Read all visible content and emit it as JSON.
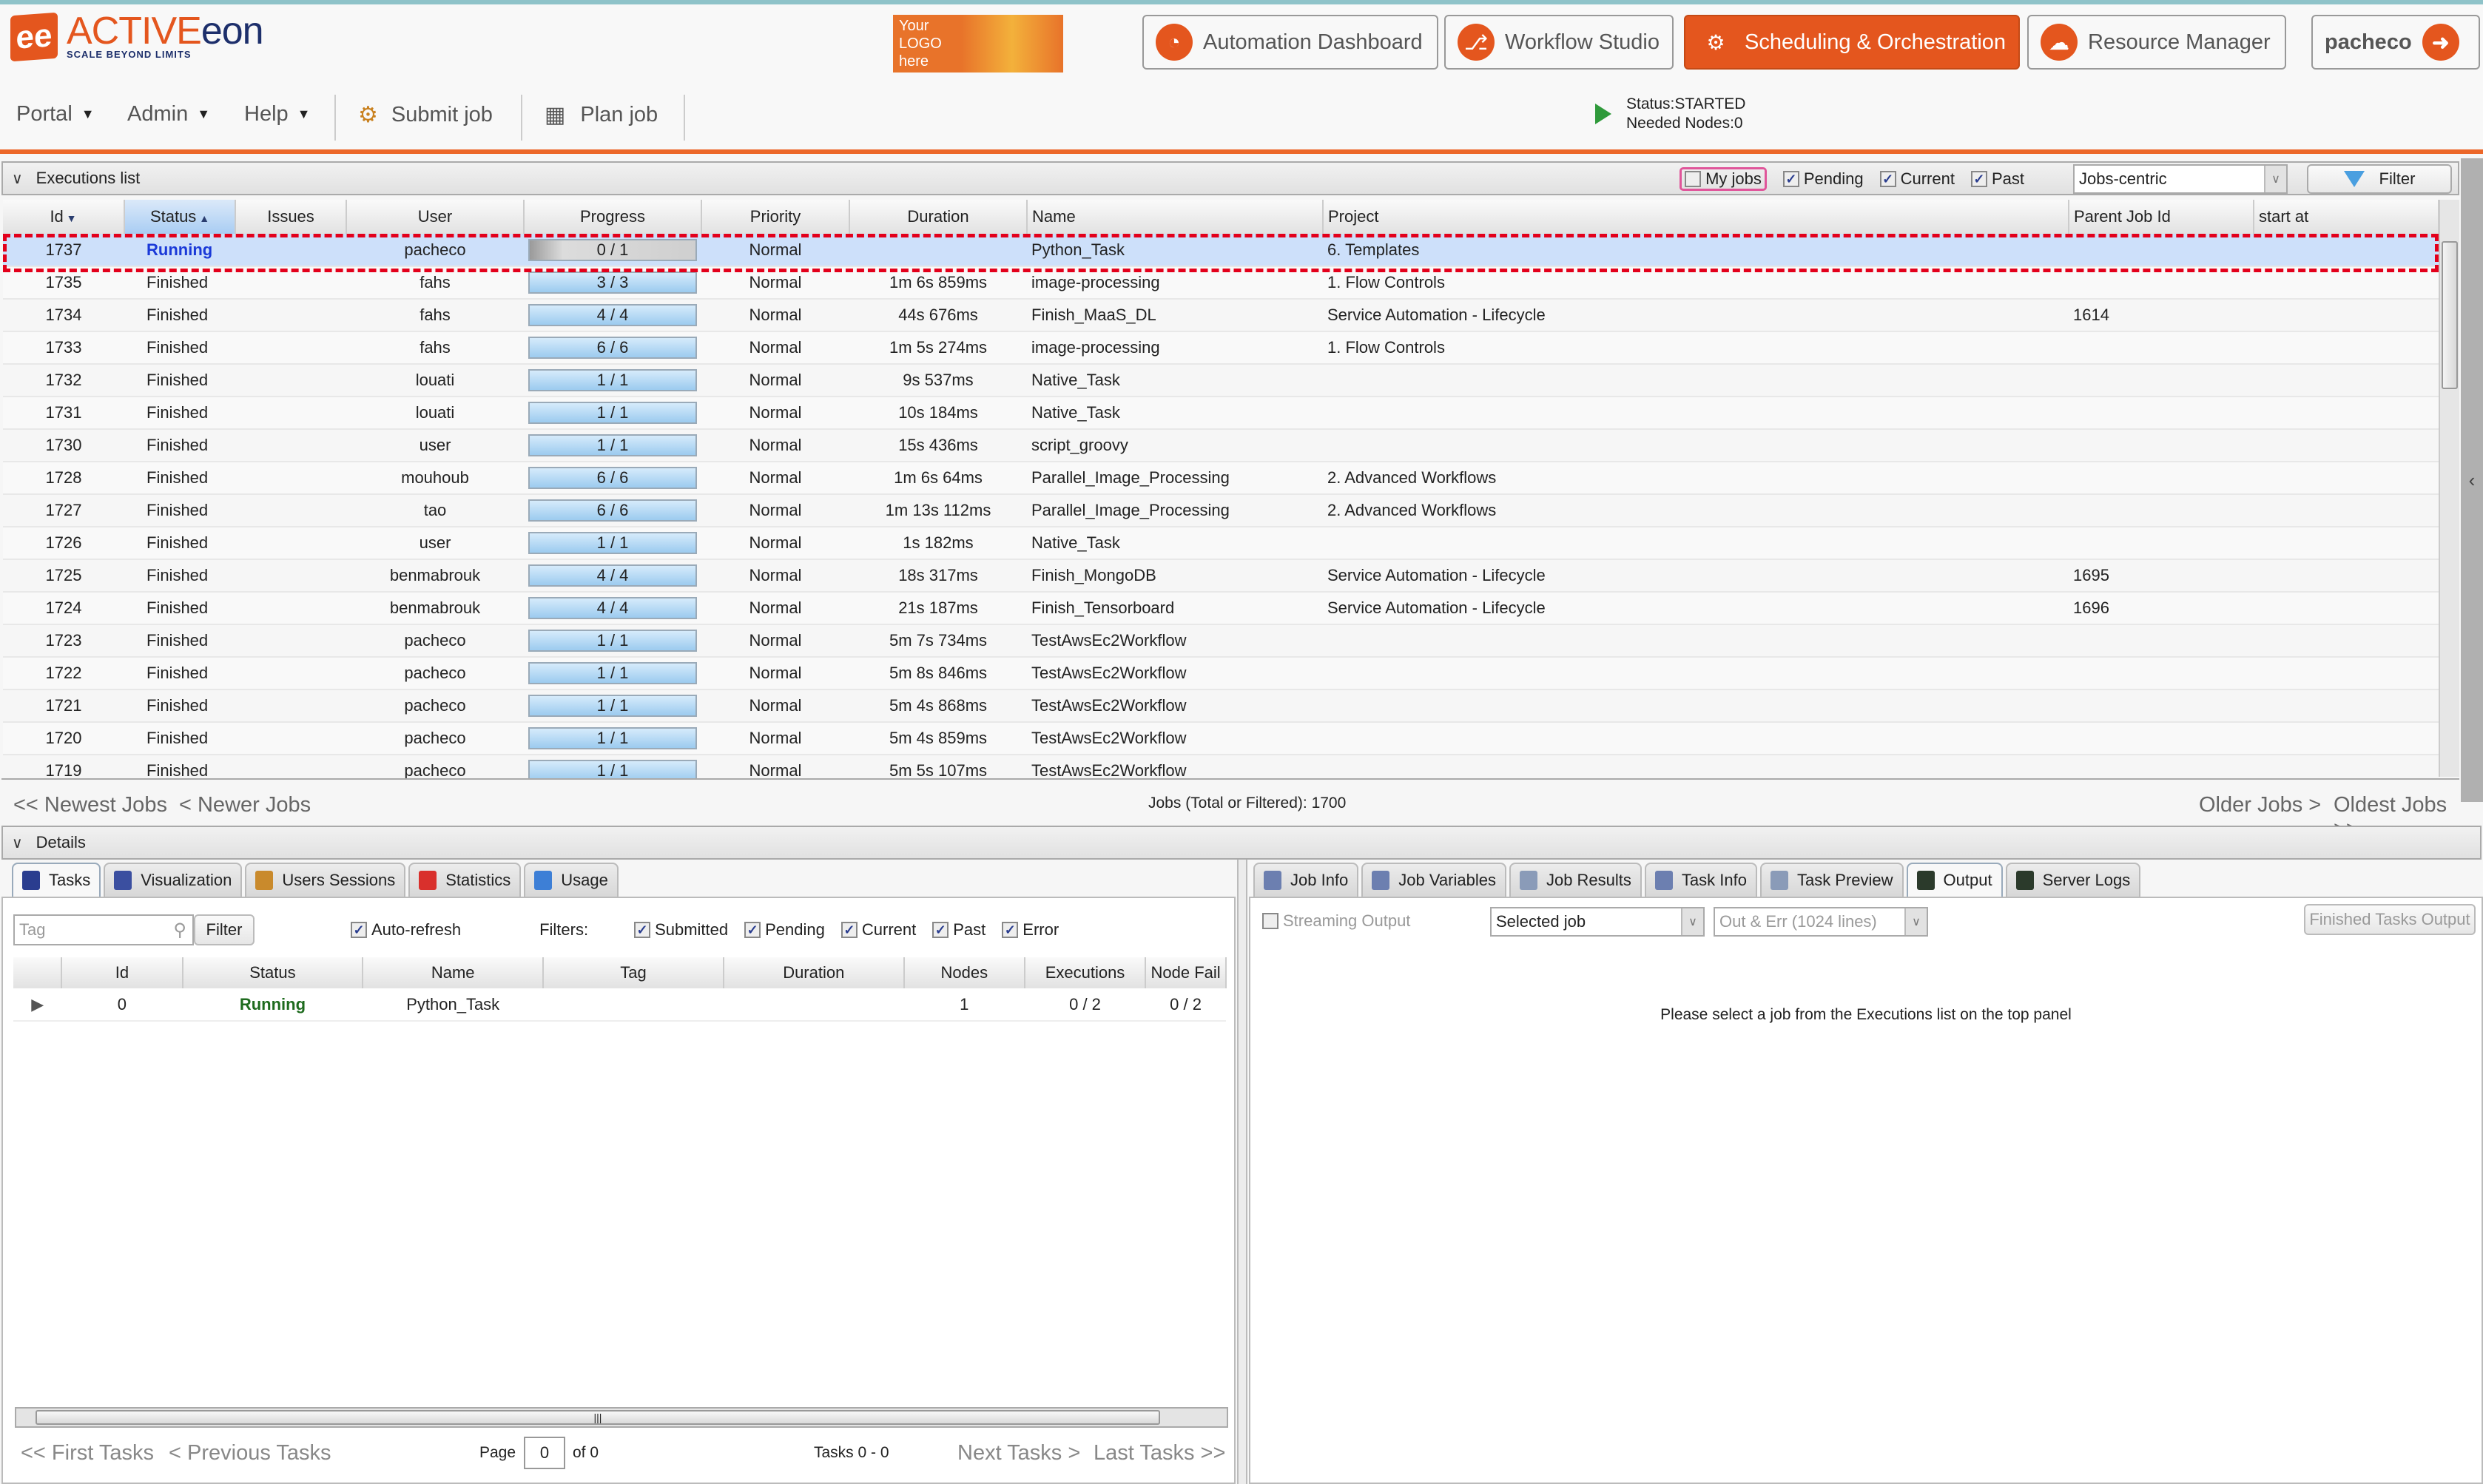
{
  "brand": {
    "name_a": "ACTIVE",
    "name_b": "eon",
    "tagline": "SCALE BEYOND LIMITS",
    "logo_mark": "ee",
    "custom_logo": [
      "Your",
      "LOGO",
      "here"
    ]
  },
  "nav": [
    {
      "label": "Automation Dashboard",
      "icon": "gauge-icon",
      "glyph": "◔",
      "active": false
    },
    {
      "label": "Workflow Studio",
      "icon": "workflow-icon",
      "glyph": "⎇",
      "active": false
    },
    {
      "label": "Scheduling & Orchestration",
      "icon": "gears-icon",
      "glyph": "⚙",
      "active": true
    },
    {
      "label": "Resource Manager",
      "icon": "cloud-icon",
      "glyph": "☁",
      "active": false
    }
  ],
  "user": {
    "name": "pacheco",
    "logout_glyph": "➜"
  },
  "toolbar": {
    "portal": "Portal",
    "admin": "Admin",
    "help": "Help",
    "submit": "Submit job",
    "plan": "Plan job",
    "caret": "▼"
  },
  "scheduler_status": {
    "status": "Status:STARTED",
    "needed_nodes": "Needed Nodes:0"
  },
  "executions": {
    "title": "Executions list",
    "filters": [
      {
        "label": "My jobs",
        "checked": false
      },
      {
        "label": "Pending",
        "checked": true
      },
      {
        "label": "Current",
        "checked": true
      },
      {
        "label": "Past",
        "checked": true
      }
    ],
    "view_mode": "Jobs-centric",
    "filter_button": "Filter",
    "columns": [
      "Id",
      "Status",
      "Issues",
      "User",
      "Progress",
      "Priority",
      "Duration",
      "Name",
      "Project",
      "Parent Job Id",
      "start at"
    ],
    "sort": {
      "Id": "desc",
      "Status": "asc"
    },
    "rows": [
      {
        "id": "1737",
        "status": "Running",
        "issues": "",
        "user": "pacheco",
        "progress": "0 / 1",
        "progress_fraction": 0,
        "priority": "Normal",
        "duration": "",
        "name": "Python_Task",
        "project": "6. Templates",
        "parent": "",
        "start": "",
        "selected": true
      },
      {
        "id": "1735",
        "status": "Finished",
        "issues": "",
        "user": "fahs",
        "progress": "3 / 3",
        "progress_fraction": 1,
        "priority": "Normal",
        "duration": "1m 6s 859ms",
        "name": "image-processing",
        "project": "1. Flow Controls",
        "parent": "",
        "start": ""
      },
      {
        "id": "1734",
        "status": "Finished",
        "issues": "",
        "user": "fahs",
        "progress": "4 / 4",
        "progress_fraction": 1,
        "priority": "Normal",
        "duration": "44s 676ms",
        "name": "Finish_MaaS_DL",
        "project": "Service Automation - Lifecycle",
        "parent": "1614",
        "start": ""
      },
      {
        "id": "1733",
        "status": "Finished",
        "issues": "",
        "user": "fahs",
        "progress": "6 / 6",
        "progress_fraction": 1,
        "priority": "Normal",
        "duration": "1m 5s 274ms",
        "name": "image-processing",
        "project": "1. Flow Controls",
        "parent": "",
        "start": ""
      },
      {
        "id": "1732",
        "status": "Finished",
        "issues": "",
        "user": "louati",
        "progress": "1 / 1",
        "progress_fraction": 1,
        "priority": "Normal",
        "duration": "9s 537ms",
        "name": "Native_Task",
        "project": "",
        "parent": "",
        "start": ""
      },
      {
        "id": "1731",
        "status": "Finished",
        "issues": "",
        "user": "louati",
        "progress": "1 / 1",
        "progress_fraction": 1,
        "priority": "Normal",
        "duration": "10s 184ms",
        "name": "Native_Task",
        "project": "",
        "parent": "",
        "start": ""
      },
      {
        "id": "1730",
        "status": "Finished",
        "issues": "",
        "user": "user",
        "progress": "1 / 1",
        "progress_fraction": 1,
        "priority": "Normal",
        "duration": "15s 436ms",
        "name": "script_groovy",
        "project": "",
        "parent": "",
        "start": ""
      },
      {
        "id": "1728",
        "status": "Finished",
        "issues": "",
        "user": "mouhoub",
        "progress": "6 / 6",
        "progress_fraction": 1,
        "priority": "Normal",
        "duration": "1m 6s 64ms",
        "name": "Parallel_Image_Processing",
        "project": "2. Advanced Workflows",
        "parent": "",
        "start": ""
      },
      {
        "id": "1727",
        "status": "Finished",
        "issues": "",
        "user": "tao",
        "progress": "6 / 6",
        "progress_fraction": 1,
        "priority": "Normal",
        "duration": "1m 13s 112ms",
        "name": "Parallel_Image_Processing",
        "project": "2. Advanced Workflows",
        "parent": "",
        "start": ""
      },
      {
        "id": "1726",
        "status": "Finished",
        "issues": "",
        "user": "user",
        "progress": "1 / 1",
        "progress_fraction": 1,
        "priority": "Normal",
        "duration": "1s 182ms",
        "name": "Native_Task",
        "project": "",
        "parent": "",
        "start": ""
      },
      {
        "id": "1725",
        "status": "Finished",
        "issues": "",
        "user": "benmabrouk",
        "progress": "4 / 4",
        "progress_fraction": 1,
        "priority": "Normal",
        "duration": "18s 317ms",
        "name": "Finish_MongoDB",
        "project": "Service Automation - Lifecycle",
        "parent": "1695",
        "start": ""
      },
      {
        "id": "1724",
        "status": "Finished",
        "issues": "",
        "user": "benmabrouk",
        "progress": "4 / 4",
        "progress_fraction": 1,
        "priority": "Normal",
        "duration": "21s 187ms",
        "name": "Finish_Tensorboard",
        "project": "Service Automation - Lifecycle",
        "parent": "1696",
        "start": ""
      },
      {
        "id": "1723",
        "status": "Finished",
        "issues": "",
        "user": "pacheco",
        "progress": "1 / 1",
        "progress_fraction": 1,
        "priority": "Normal",
        "duration": "5m 7s 734ms",
        "name": "TestAwsEc2Workflow",
        "project": "",
        "parent": "",
        "start": ""
      },
      {
        "id": "1722",
        "status": "Finished",
        "issues": "",
        "user": "pacheco",
        "progress": "1 / 1",
        "progress_fraction": 1,
        "priority": "Normal",
        "duration": "5m 8s 846ms",
        "name": "TestAwsEc2Workflow",
        "project": "",
        "parent": "",
        "start": ""
      },
      {
        "id": "1721",
        "status": "Finished",
        "issues": "",
        "user": "pacheco",
        "progress": "1 / 1",
        "progress_fraction": 1,
        "priority": "Normal",
        "duration": "5m 4s 868ms",
        "name": "TestAwsEc2Workflow",
        "project": "",
        "parent": "",
        "start": ""
      },
      {
        "id": "1720",
        "status": "Finished",
        "issues": "",
        "user": "pacheco",
        "progress": "1 / 1",
        "progress_fraction": 1,
        "priority": "Normal",
        "duration": "5m 4s 859ms",
        "name": "TestAwsEc2Workflow",
        "project": "",
        "parent": "",
        "start": ""
      },
      {
        "id": "1719",
        "status": "Finished",
        "issues": "",
        "user": "pacheco",
        "progress": "1 / 1",
        "progress_fraction": 1,
        "priority": "Normal",
        "duration": "5m 5s 107ms",
        "name": "TestAwsEc2Workflow",
        "project": "",
        "parent": "",
        "start": ""
      }
    ],
    "pager": {
      "newest": "<< Newest Jobs",
      "newer": "< Newer Jobs",
      "count": "Jobs (Total or Filtered): 1700",
      "older": "Older Jobs >",
      "oldest": "Oldest Jobs >>"
    }
  },
  "details": {
    "title": "Details",
    "left_tabs": [
      {
        "label": "Tasks",
        "active": true,
        "color": "#2a3d8f"
      },
      {
        "label": "Visualization",
        "color": "#3b4fa0"
      },
      {
        "label": "Users Sessions",
        "color": "#c98a2c"
      },
      {
        "label": "Statistics",
        "color": "#d9302c"
      },
      {
        "label": "Usage",
        "color": "#3d7fd6"
      }
    ],
    "tag_placeholder": "Tag",
    "filter_button": "Filter",
    "auto_refresh": {
      "label": "Auto-refresh",
      "checked": true
    },
    "filters_label": "Filters:",
    "task_filters": [
      {
        "label": "Submitted",
        "checked": true
      },
      {
        "label": "Pending",
        "checked": true
      },
      {
        "label": "Current",
        "checked": true
      },
      {
        "label": "Past",
        "checked": true
      },
      {
        "label": "Error",
        "checked": true
      }
    ],
    "task_columns": [
      "",
      "Id",
      "Status",
      "Name",
      "Tag",
      "Duration",
      "Nodes",
      "Executions",
      "Node Fail"
    ],
    "tasks": [
      {
        "id": "0",
        "status": "Running",
        "name": "Python_Task",
        "tag": "",
        "duration": "",
        "nodes": "1",
        "executions": "0 / 2",
        "node_fail": "0 / 2"
      }
    ],
    "task_pager": {
      "first": "<< First Tasks",
      "prev": "< Previous Tasks",
      "page_label": "Page",
      "page": "0",
      "of": "of 0",
      "range": "Tasks 0 - 0",
      "next": "Next Tasks >",
      "last": "Last Tasks >>"
    },
    "right_tabs": [
      {
        "label": "Job Info",
        "color": "#6c7fb0"
      },
      {
        "label": "Job Variables",
        "color": "#6c7fb0"
      },
      {
        "label": "Job Results",
        "color": "#8a9bb8"
      },
      {
        "label": "Task Info",
        "color": "#6c7fb0"
      },
      {
        "label": "Task Preview",
        "color": "#8a9bb8"
      },
      {
        "label": "Output",
        "active": true,
        "color": "#2b3a2b"
      },
      {
        "label": "Server Logs",
        "color": "#2b3a2b"
      }
    ],
    "streaming_output": {
      "label": "Streaming Output",
      "checked": false
    },
    "job_selector": "Selected job",
    "lines_selector": "Out & Err (1024 lines)",
    "finished_output_button": "Finished Tasks Output",
    "empty_message": "Please select a job from the Executions list on the top panel"
  }
}
